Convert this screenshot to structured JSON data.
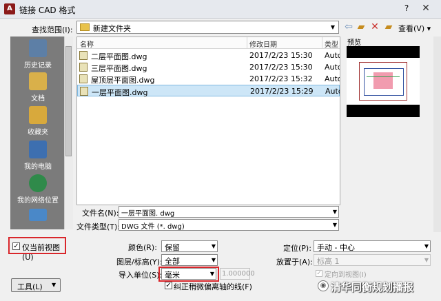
{
  "window": {
    "title": "链接 CAD 格式",
    "help": "?",
    "close": "✕",
    "app_icon_text": "A"
  },
  "lookin": {
    "label": "查找范围(I):",
    "value": "新建文件夹"
  },
  "toolbar": {
    "view_label": "查看(V)"
  },
  "places": [
    {
      "label": "历史记录",
      "icon": "history-icon",
      "color": "#5d7fa6"
    },
    {
      "label": "文档",
      "icon": "documents-icon",
      "color": "#d9b04a"
    },
    {
      "label": "收藏夹",
      "icon": "favorites-icon",
      "color": "#d8a93c"
    },
    {
      "label": "我的电脑",
      "icon": "computer-icon",
      "color": "#3d6fb0"
    },
    {
      "label": "我的网络位置",
      "icon": "network-icon",
      "color": "#2f8a4a"
    }
  ],
  "filelist": {
    "columns": [
      "名称",
      "修改日期",
      "类型"
    ],
    "rows": [
      {
        "name": "二层平面图.dwg",
        "date": "2017/2/23 15:30",
        "type": "Autc",
        "selected": false
      },
      {
        "name": "三层平面图.dwg",
        "date": "2017/2/23 15:30",
        "type": "Autc",
        "selected": false
      },
      {
        "name": "屋顶层平面图.dwg",
        "date": "2017/2/23 15:32",
        "type": "Autc",
        "selected": false
      },
      {
        "name": "一层平面图.dwg",
        "date": "2017/2/23 15:29",
        "type": "Autc",
        "selected": true
      }
    ]
  },
  "preview": {
    "label": "预览"
  },
  "filename": {
    "label": "文件名(N):",
    "value": "一层平面图. dwg"
  },
  "filetype": {
    "label": "文件类型(T):",
    "value": "DWG 文件 (*. dwg)"
  },
  "options": {
    "current_view_label": "仅当前视图(U)",
    "current_view_checked": true,
    "color_label": "颜色(R):",
    "color_value": "保留",
    "layers_label": "图层/标高(Y):",
    "layers_value": "全部",
    "units_label": "导入单位(S):",
    "units_value": "毫米",
    "scale_value": "1.000000",
    "correct_lines_label": "纠正稍微偏离轴的线(F)",
    "correct_lines_checked": true,
    "position_label": "定位(P):",
    "position_value": "手动 - 中心",
    "place_at_label": "放置于(A):",
    "place_at_value": "标高 1",
    "orient_label": "定向到视图(I)"
  },
  "tools": {
    "label": "工具(L)"
  },
  "watermark": {
    "text": "清华同衡规划播报"
  }
}
